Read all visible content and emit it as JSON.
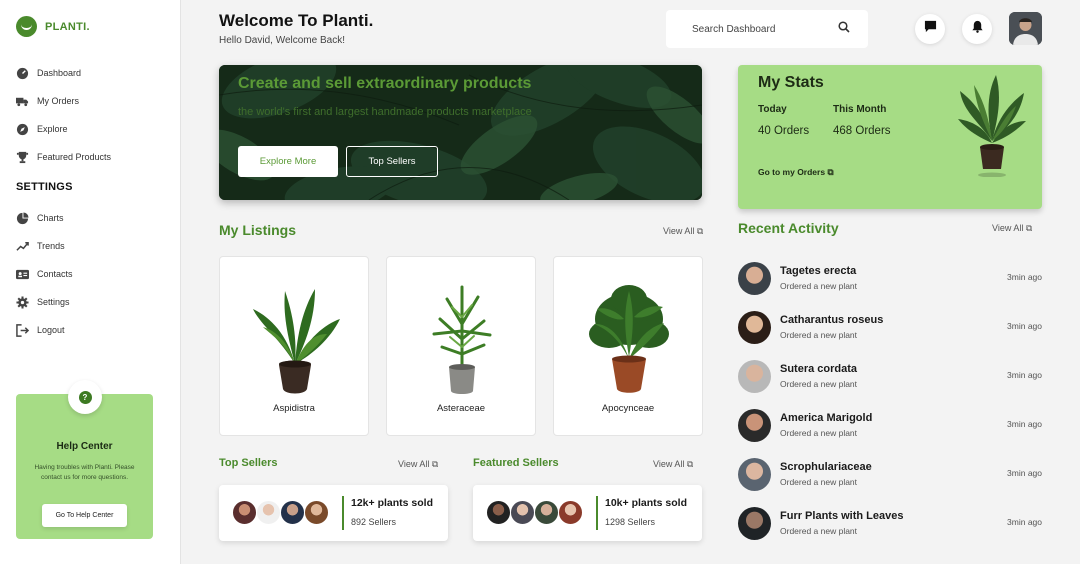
{
  "brand": {
    "name": "PLANTI.",
    "accent": "#4a8a2c",
    "panel_green": "#a6dc85"
  },
  "sidebar": {
    "items": [
      {
        "label": "Dashboard",
        "icon": "gauge-icon"
      },
      {
        "label": "My Orders",
        "icon": "truck-icon"
      },
      {
        "label": "Explore",
        "icon": "compass-icon"
      },
      {
        "label": "Featured Products",
        "icon": "trophy-icon"
      }
    ],
    "settings_heading": "SETTINGS",
    "settings_items": [
      {
        "label": "Charts",
        "icon": "pie-chart-icon"
      },
      {
        "label": "Trends",
        "icon": "trend-up-icon"
      },
      {
        "label": "Contacts",
        "icon": "contact-card-icon"
      },
      {
        "label": "Settings",
        "icon": "gear-icon"
      },
      {
        "label": "Logout",
        "icon": "logout-icon"
      }
    ],
    "help": {
      "icon": "question-icon",
      "title": "Help Center",
      "description": "Having troubles with Planti. Please contact us for more questions.",
      "button": "Go To Help Center"
    }
  },
  "header": {
    "title": "Welcome To Planti.",
    "subtitle": "Hello David, Welcome Back!",
    "search_placeholder": "Search Dashboard"
  },
  "hero": {
    "title": "Create and sell extraordinary products",
    "subtitle": "the world's first and largest handmade products marketplace",
    "btn_explore": "Explore More",
    "btn_sellers": "Top Sellers"
  },
  "stats": {
    "title": "My Stats",
    "today_label": "Today",
    "today_value": "40 Orders",
    "month_label": "This Month",
    "month_value": "468 Orders",
    "link": "Go to my Orders"
  },
  "listings": {
    "title": "My Listings",
    "view_all": "View All",
    "items": [
      "Aspidistra",
      "Asteraceae",
      "Apocynceae"
    ]
  },
  "top_sellers": {
    "title": "Top Sellers",
    "view_all": "View All",
    "main": "12k+ plants sold",
    "sub": "892 Sellers"
  },
  "featured_sellers": {
    "title": "Featured Sellers",
    "view_all": "View All",
    "main": "10k+ plants sold",
    "sub": "1298 Sellers"
  },
  "activity": {
    "title": "Recent Activity",
    "view_all": "View All",
    "items": [
      {
        "name": "Tagetes erecta",
        "desc": "Ordered a new plant",
        "time": "3min ago"
      },
      {
        "name": "Catharantus roseus",
        "desc": "Ordered a new plant",
        "time": "3min ago"
      },
      {
        "name": "Sutera cordata",
        "desc": "Ordered a new plant",
        "time": "3min ago"
      },
      {
        "name": "America Marigold",
        "desc": "Ordered a new plant",
        "time": "3min ago"
      },
      {
        "name": "Scrophulariaceae",
        "desc": "Ordered a new plant",
        "time": "3min ago"
      },
      {
        "name": "Furr Plants with Leaves",
        "desc": "Ordered a new plant",
        "time": "3min ago"
      }
    ]
  }
}
